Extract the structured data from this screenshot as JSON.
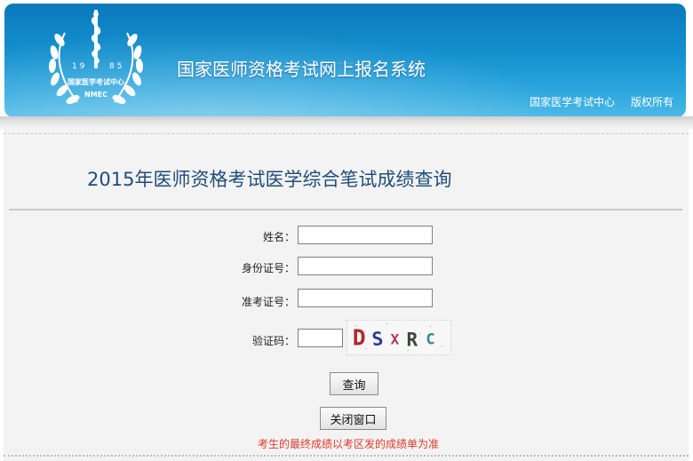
{
  "header": {
    "system_title": "国家医师资格考试网上报名系统",
    "links": [
      "国家医学考试中心",
      "版权所有"
    ],
    "emblem": {
      "year_left": "1 9",
      "year_right": "8 5",
      "org_name": "国家医学考试中心",
      "abbr": "NMEC"
    }
  },
  "page": {
    "title": "2015年医师资格考试医学综合笔试成绩查询"
  },
  "form": {
    "name_label": "姓名：",
    "name_value": "",
    "id_label": "身份证号：",
    "id_value": "",
    "ticket_label": "准考证号：",
    "ticket_value": "",
    "captcha_label": "验证码：",
    "captcha_value": "",
    "captcha_text": "DSXRC",
    "query_button": "查询",
    "close_button": "关闭窗口",
    "notice": "考生的最终成绩以考区发的成绩单为准"
  },
  "colors": {
    "header_blue": "#1591cf",
    "title_blue": "#1f4d7a",
    "notice_red": "#e03a2a"
  }
}
